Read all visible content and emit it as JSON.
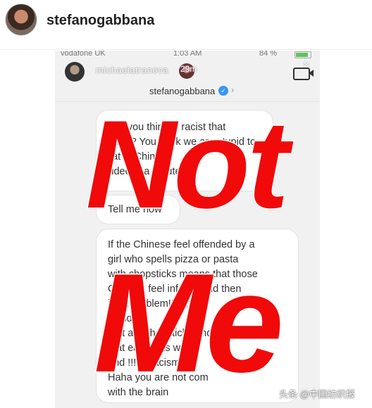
{
  "post": {
    "username": "stefanogabbana"
  },
  "status_bar": {
    "carrier": "vodafone UK",
    "time": "1:03 AM",
    "battery": "84 %"
  },
  "dm": {
    "sender": "michaelatranova",
    "sender_time": "29m",
    "thread_title": "stefanogabbana",
    "chevron": "›",
    "close": "×"
  },
  "messages": [
    {
      "lines": [
        "why you think is racist that",
        "video? You think we are stupid to",
        "eat in China",
        "video is a tribute"
      ]
    },
    {
      "lines": [
        "Tell me now"
      ]
    },
    {
      "lines": [
        "If the Chinese feel offended by a",
        "girl who spells pizza or pasta",
        "with chopsticks means that those",
        "Chinese feel inferior and then",
        "it's a problem!!! The",
        "world",
        "that ate chopsticks and",
        "that eat sticks w",
        "and !!! Is racism?",
        "Haha you are not com",
        "with the brain"
      ]
    }
  ],
  "overlay": {
    "top_word": "Not",
    "bottom_word": "Me",
    "color": "#f00a0a"
  },
  "watermark": "头条 @中国纺织报",
  "icons": [
    "avatar",
    "video-call-icon",
    "verified-icon",
    "close-icon",
    "chevron-right-icon",
    "battery-icon"
  ]
}
